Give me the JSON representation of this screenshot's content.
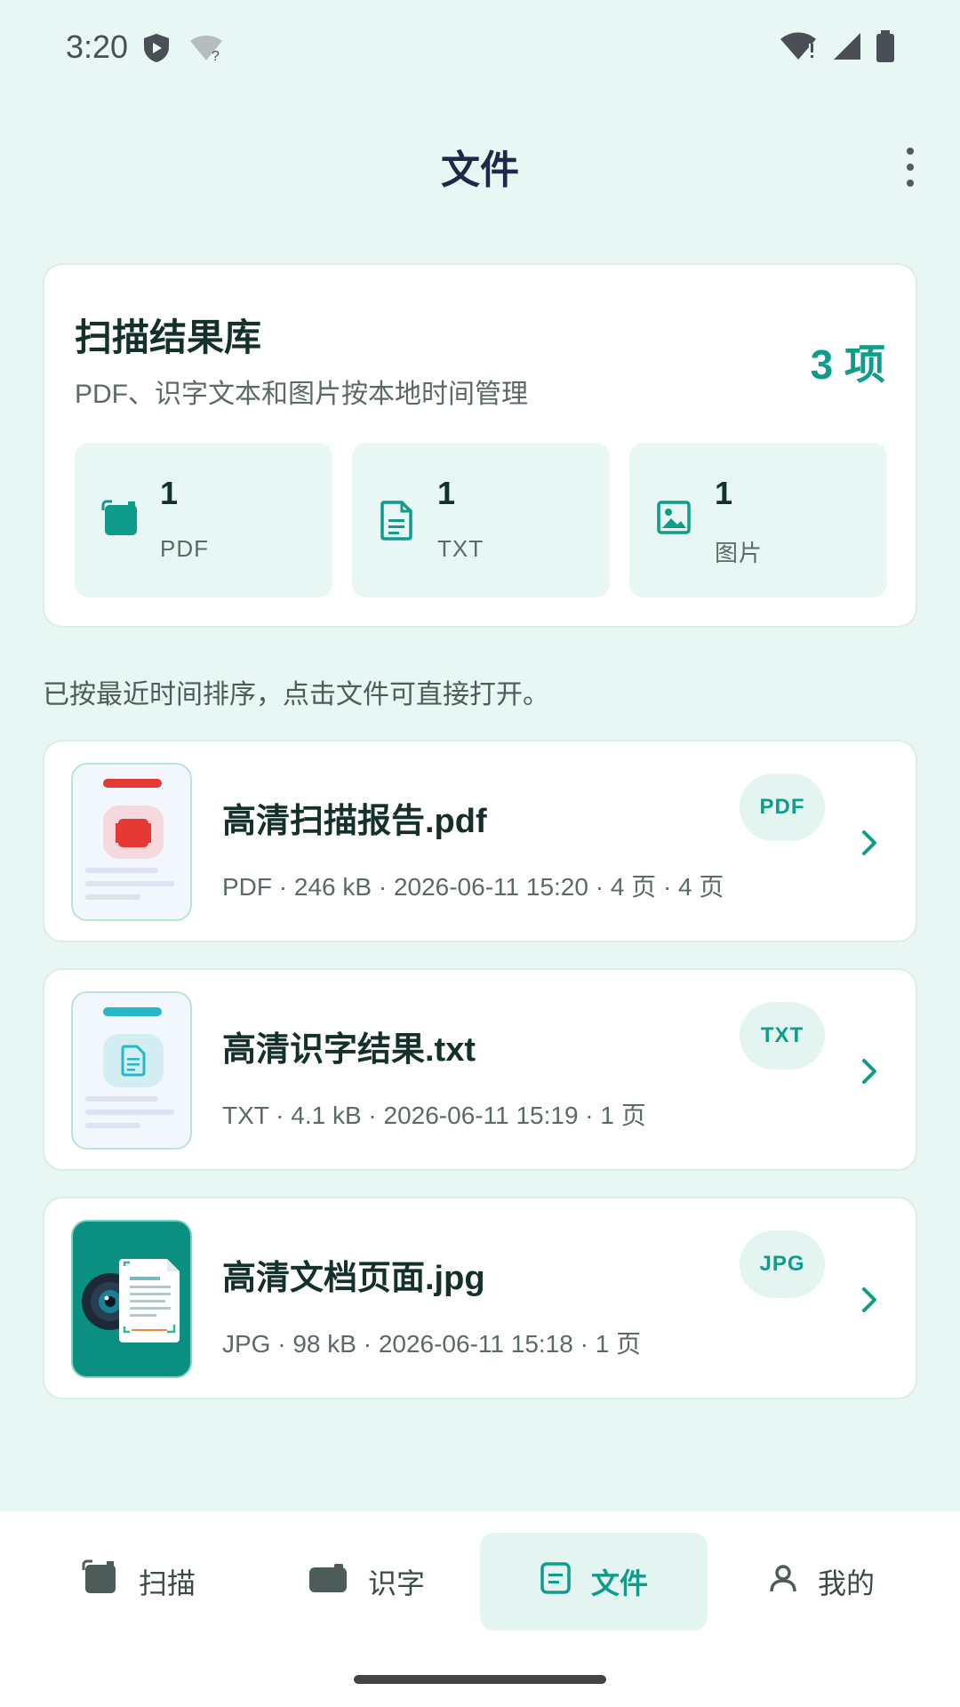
{
  "status_bar": {
    "time": "3:20"
  },
  "header": {
    "title": "文件"
  },
  "summary": {
    "title": "扫描结果库",
    "subtitle": "PDF、识字文本和图片按本地时间管理",
    "count": "3 项",
    "stats": [
      {
        "value": "1",
        "label": "PDF",
        "icon": "scan-doc-icon"
      },
      {
        "value": "1",
        "label": "TXT",
        "icon": "text-file-icon"
      },
      {
        "value": "1",
        "label": "图片",
        "icon": "image-icon"
      }
    ]
  },
  "hint": "已按最近时间排序，点击文件可直接打开。",
  "files": [
    {
      "name": "高清扫描报告.pdf",
      "meta": "PDF · 246 kB · 2026-06-11 15:20 · 4 页 · 4 页",
      "badge": "PDF"
    },
    {
      "name": "高清识字结果.txt",
      "meta": "TXT · 4.1 kB · 2026-06-11 15:19 · 1 页",
      "badge": "TXT"
    },
    {
      "name": "高清文档页面.jpg",
      "meta": "JPG · 98 kB · 2026-06-11 15:18 · 1 页",
      "badge": "JPG"
    }
  ],
  "nav": [
    {
      "label": "扫描",
      "icon": "scan-icon"
    },
    {
      "label": "识字",
      "icon": "camera-icon"
    },
    {
      "label": "文件",
      "icon": "file-icon",
      "active": true
    },
    {
      "label": "我的",
      "icon": "person-icon"
    }
  ],
  "colors": {
    "accent": "#0f9c8a",
    "background": "#e8f7f3",
    "pdf_red": "#e53935"
  }
}
